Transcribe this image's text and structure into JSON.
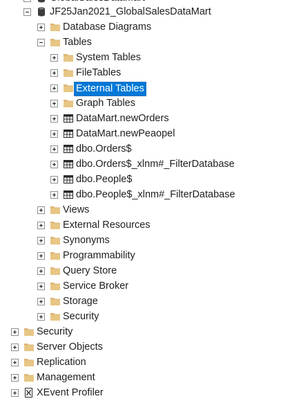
{
  "tree": {
    "top_partial": {
      "label": "GlobalSalesDataMart"
    },
    "database": {
      "label": "JF25Jan2021_GlobalSalesDataMart"
    },
    "database_diagrams": {
      "label": "Database Diagrams"
    },
    "tables": {
      "label": "Tables",
      "children": [
        {
          "label": "System Tables",
          "icon": "folder"
        },
        {
          "label": "FileTables",
          "icon": "folder"
        },
        {
          "label": "External Tables",
          "icon": "folder",
          "selected": true
        },
        {
          "label": "Graph Tables",
          "icon": "folder"
        },
        {
          "label": "DataMart.newOrders",
          "icon": "table"
        },
        {
          "label": "DataMart.newPeaopel",
          "icon": "table"
        },
        {
          "label": "dbo.Orders$",
          "icon": "table"
        },
        {
          "label": "dbo.Orders$_xlnm#_FilterDatabase",
          "icon": "table"
        },
        {
          "label": "dbo.People$",
          "icon": "table"
        },
        {
          "label": "dbo.People$_xlnm#_FilterDatabase",
          "icon": "table"
        }
      ]
    },
    "db_folders": [
      "Views",
      "External Resources",
      "Synonyms",
      "Programmability",
      "Query Store",
      "Service Broker",
      "Storage",
      "Security"
    ],
    "server_nodes": [
      {
        "label": "Security",
        "icon": "folder"
      },
      {
        "label": "Server Objects",
        "icon": "folder"
      },
      {
        "label": "Replication",
        "icon": "folder"
      },
      {
        "label": "Management",
        "icon": "folder"
      },
      {
        "label": "XEvent Profiler",
        "icon": "xevent"
      }
    ]
  },
  "colors": {
    "folder": "#dcb67a",
    "folder_dark": "#c9a063",
    "selection": "#0078d7",
    "database": "#3c3c3c"
  }
}
